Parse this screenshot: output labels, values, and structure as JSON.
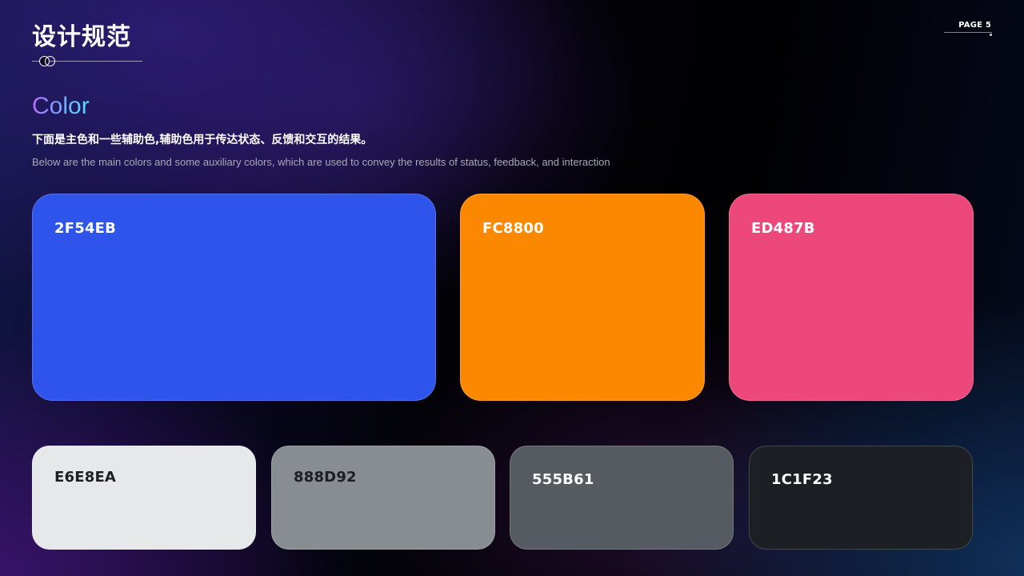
{
  "header": {
    "title": "设计规范",
    "page_label": "PAGE 5"
  },
  "section": {
    "title": "Color",
    "description_cn": "下面是主色和一些辅助色,辅助色用于传达状态、反馈和交互的结果。",
    "description_en": "Below are the main colors and some auxiliary colors, which are used to convey the results of status, feedback, and interaction"
  },
  "primary_colors": [
    {
      "code": "2F54EB",
      "hex": "#2F54EB",
      "text_color": "#ffffff"
    },
    {
      "code": "FC8800",
      "hex": "#FC8800",
      "text_color": "#ffffff"
    },
    {
      "code": "ED487B",
      "hex": "#ED487B",
      "text_color": "#ffffff"
    }
  ],
  "neutral_colors": [
    {
      "code": "E6E8EA",
      "hex": "#E6E8EA",
      "text_color": "#1c1f23"
    },
    {
      "code": "888D92",
      "hex": "#888D92",
      "text_color": "#1c1f23"
    },
    {
      "code": "555B61",
      "hex": "#555B61",
      "text_color": "#ffffff"
    },
    {
      "code": "1C1F23",
      "hex": "#1C1F23",
      "text_color": "#ffffff"
    }
  ],
  "icons": {
    "title_ornament": "double-ring-icon"
  }
}
